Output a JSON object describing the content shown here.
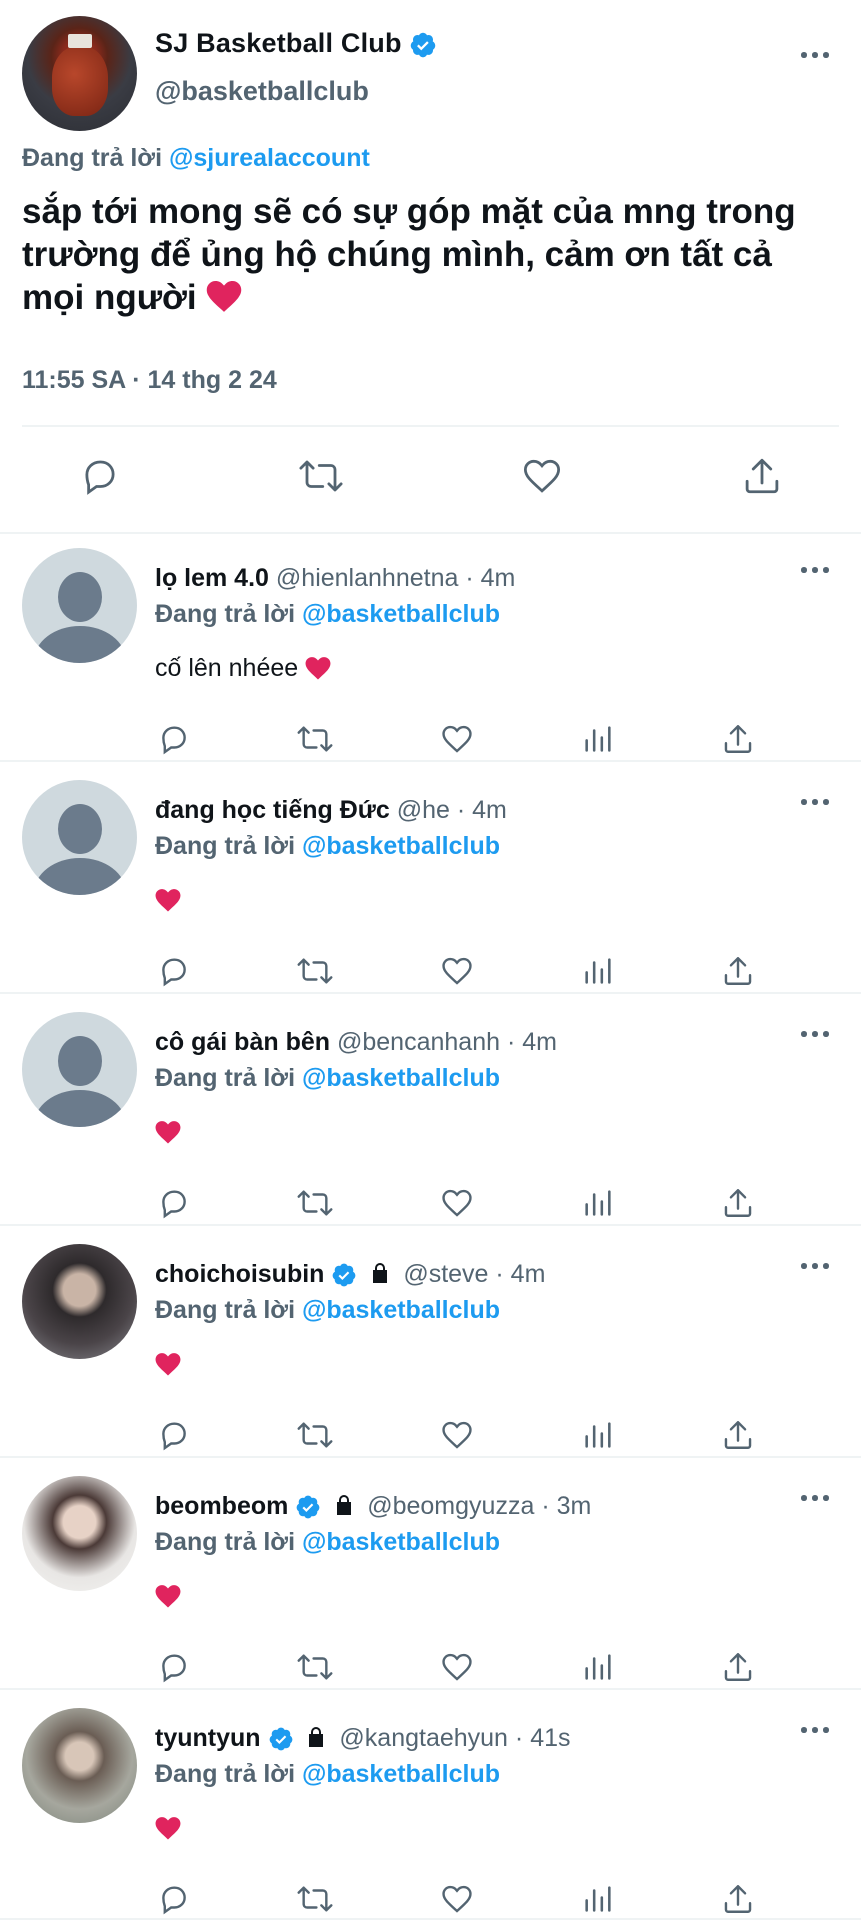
{
  "main_tweet": {
    "display_name": "SJ Basketball Club",
    "handle": "@basketballclub",
    "replying_prefix": "Đang trả lời",
    "replying_to": "@sjurealaccount",
    "text": "sắp tới mong sẽ có sự góp mặt của mng trong trường để ủng hộ chúng mình, cảm ơn tất cả mọi người",
    "timestamp": "11:55 SA · 14 thg 2 24",
    "avatar_icon": "basketball-avatar",
    "verified_color": "#1d9bf0"
  },
  "replies": [
    {
      "name": "lọ lem 4.0",
      "handle": "@hienlanhnetna",
      "time": "· 4m",
      "replying_prefix": "Đang trả lời",
      "replying_to": "@basketballclub",
      "text": "cố lên nhéee",
      "verified": false,
      "locked": false,
      "avatar": "default-avatar"
    },
    {
      "name": "đang học tiếng Đức",
      "handle": "@he",
      "time": "· 4m",
      "replying_prefix": "Đang trả lời",
      "replying_to": "@basketballclub",
      "text": "",
      "verified": false,
      "locked": false,
      "avatar": "default-avatar"
    },
    {
      "name": "cô gái bàn bên",
      "handle": "@bencanhanh",
      "time": "· 4m",
      "replying_prefix": "Đang trả lời",
      "replying_to": "@basketballclub",
      "text": "",
      "verified": false,
      "locked": false,
      "avatar": "default-avatar"
    },
    {
      "name": "choichoisubin",
      "handle": "@steve",
      "time": "· 4m",
      "replying_prefix": "Đang trả lời",
      "replying_to": "@basketballclub",
      "text": "",
      "verified": true,
      "locked": true,
      "avatar": "photo-avatar"
    },
    {
      "name": "beombeom",
      "handle": "@beomgyuzza",
      "time": "· 3m",
      "replying_prefix": "Đang trả lời",
      "replying_to": "@basketballclub",
      "text": "",
      "verified": true,
      "locked": true,
      "avatar": "photo-avatar"
    },
    {
      "name": "tyuntyun",
      "handle": "@kangtaehyun",
      "time": "· 41s",
      "replying_prefix": "Đang trả lời",
      "replying_to": "@basketballclub",
      "text": "",
      "verified": true,
      "locked": true,
      "avatar": "photo-avatar"
    }
  ],
  "colors": {
    "accent": "#1d9bf0",
    "muted": "#536471",
    "text": "#0f1419",
    "heart": "#e0245e"
  }
}
